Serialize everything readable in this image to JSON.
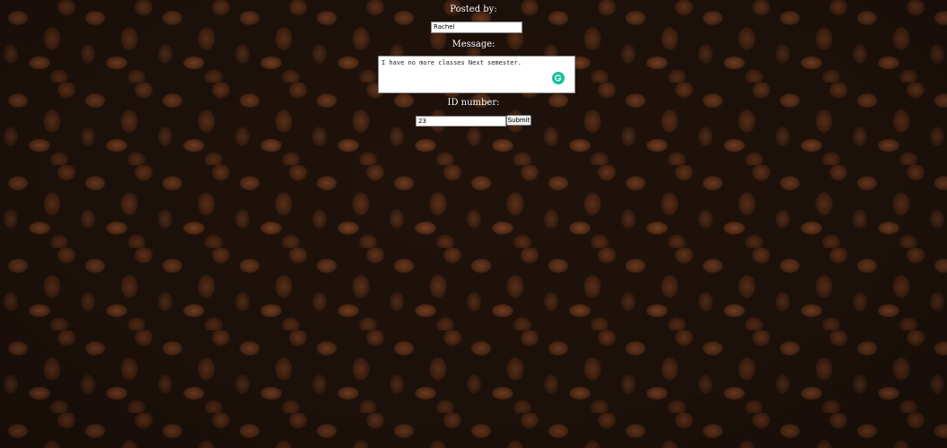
{
  "form": {
    "posted_by_label": "Posted by:",
    "name_value": "Rachel",
    "message_label": "Message:",
    "message_value": "I have no more classes Next semester.",
    "id_label": "ID number:",
    "id_value": "23",
    "submit_label": "Submit"
  },
  "icons": {
    "grammar": "grammarly-icon"
  },
  "colors": {
    "label_text": "#ffffff",
    "grammar_badge": "#15c39a",
    "background": "#2a170d"
  }
}
